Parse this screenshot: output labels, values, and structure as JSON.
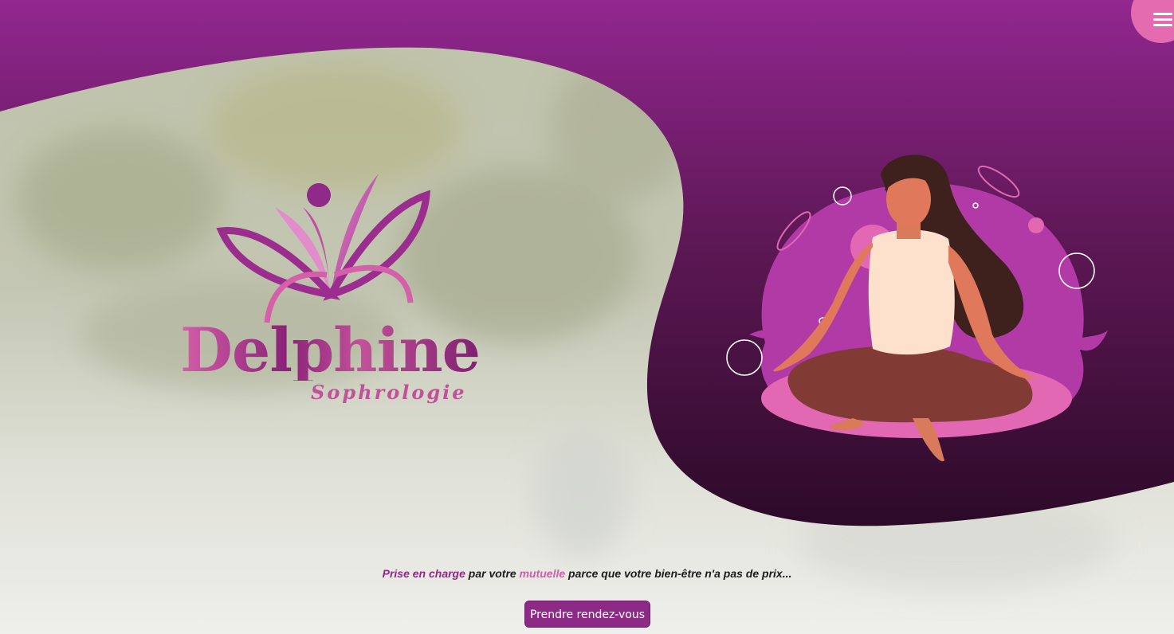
{
  "header": {
    "menu_icon": "hamburger-menu-icon"
  },
  "brand": {
    "name": "Delphine",
    "subtitle": "Sophrologie",
    "logo_icon": "butterfly-figure-logo"
  },
  "hero": {
    "illustration_icon": "meditating-woman-illustration",
    "tagline": {
      "part1": "Prise en charge",
      "part2": " par votre ",
      "part3": "mutuelle",
      "part4": " parce que votre bien-être n'a pas de prix..."
    },
    "cta_label": "Prendre rendez-vous"
  },
  "colors": {
    "primary_purple": "#8e2a88",
    "dark_purple": "#3a0e35",
    "pink_accent": "#e46bb0",
    "button_bg": "#8c2a86"
  }
}
